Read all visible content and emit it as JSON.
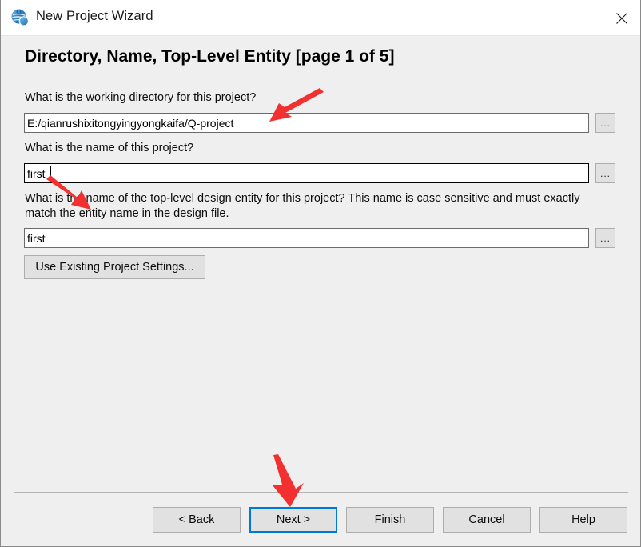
{
  "window": {
    "title": "New Project Wizard",
    "app_icon": "quartus-globe-icon",
    "close_icon": "close-icon"
  },
  "page": {
    "heading": "Directory, Name, Top-Level Entity [page 1 of 5]"
  },
  "fields": [
    {
      "label": "What is the working directory for this project?",
      "value": "E:/qianrushixitongyingyongkaifa/Q-project",
      "browse_label": "...",
      "focused": false
    },
    {
      "label": "What is the name of this project?",
      "value": "first",
      "browse_label": "...",
      "focused": true
    },
    {
      "label": "What is the name of the top-level design entity for this project? This name is case sensitive and must exactly match the entity name in the design file.",
      "value": "first",
      "browse_label": "...",
      "focused": false
    }
  ],
  "use_existing_button": "Use Existing Project Settings...",
  "footer": {
    "back": "< Back",
    "next": "Next >",
    "finish": "Finish",
    "cancel": "Cancel",
    "help": "Help"
  },
  "colors": {
    "accent": "#0078d7",
    "annotation": "#f23030",
    "dialog_bg": "#efefef",
    "titlebar_bg": "#ffffff",
    "button_bg": "#e1e1e1"
  },
  "annotations": [
    {
      "name": "arrow-to-working-directory-field"
    },
    {
      "name": "arrow-to-project-name-field"
    },
    {
      "name": "arrow-to-next-button"
    }
  ]
}
